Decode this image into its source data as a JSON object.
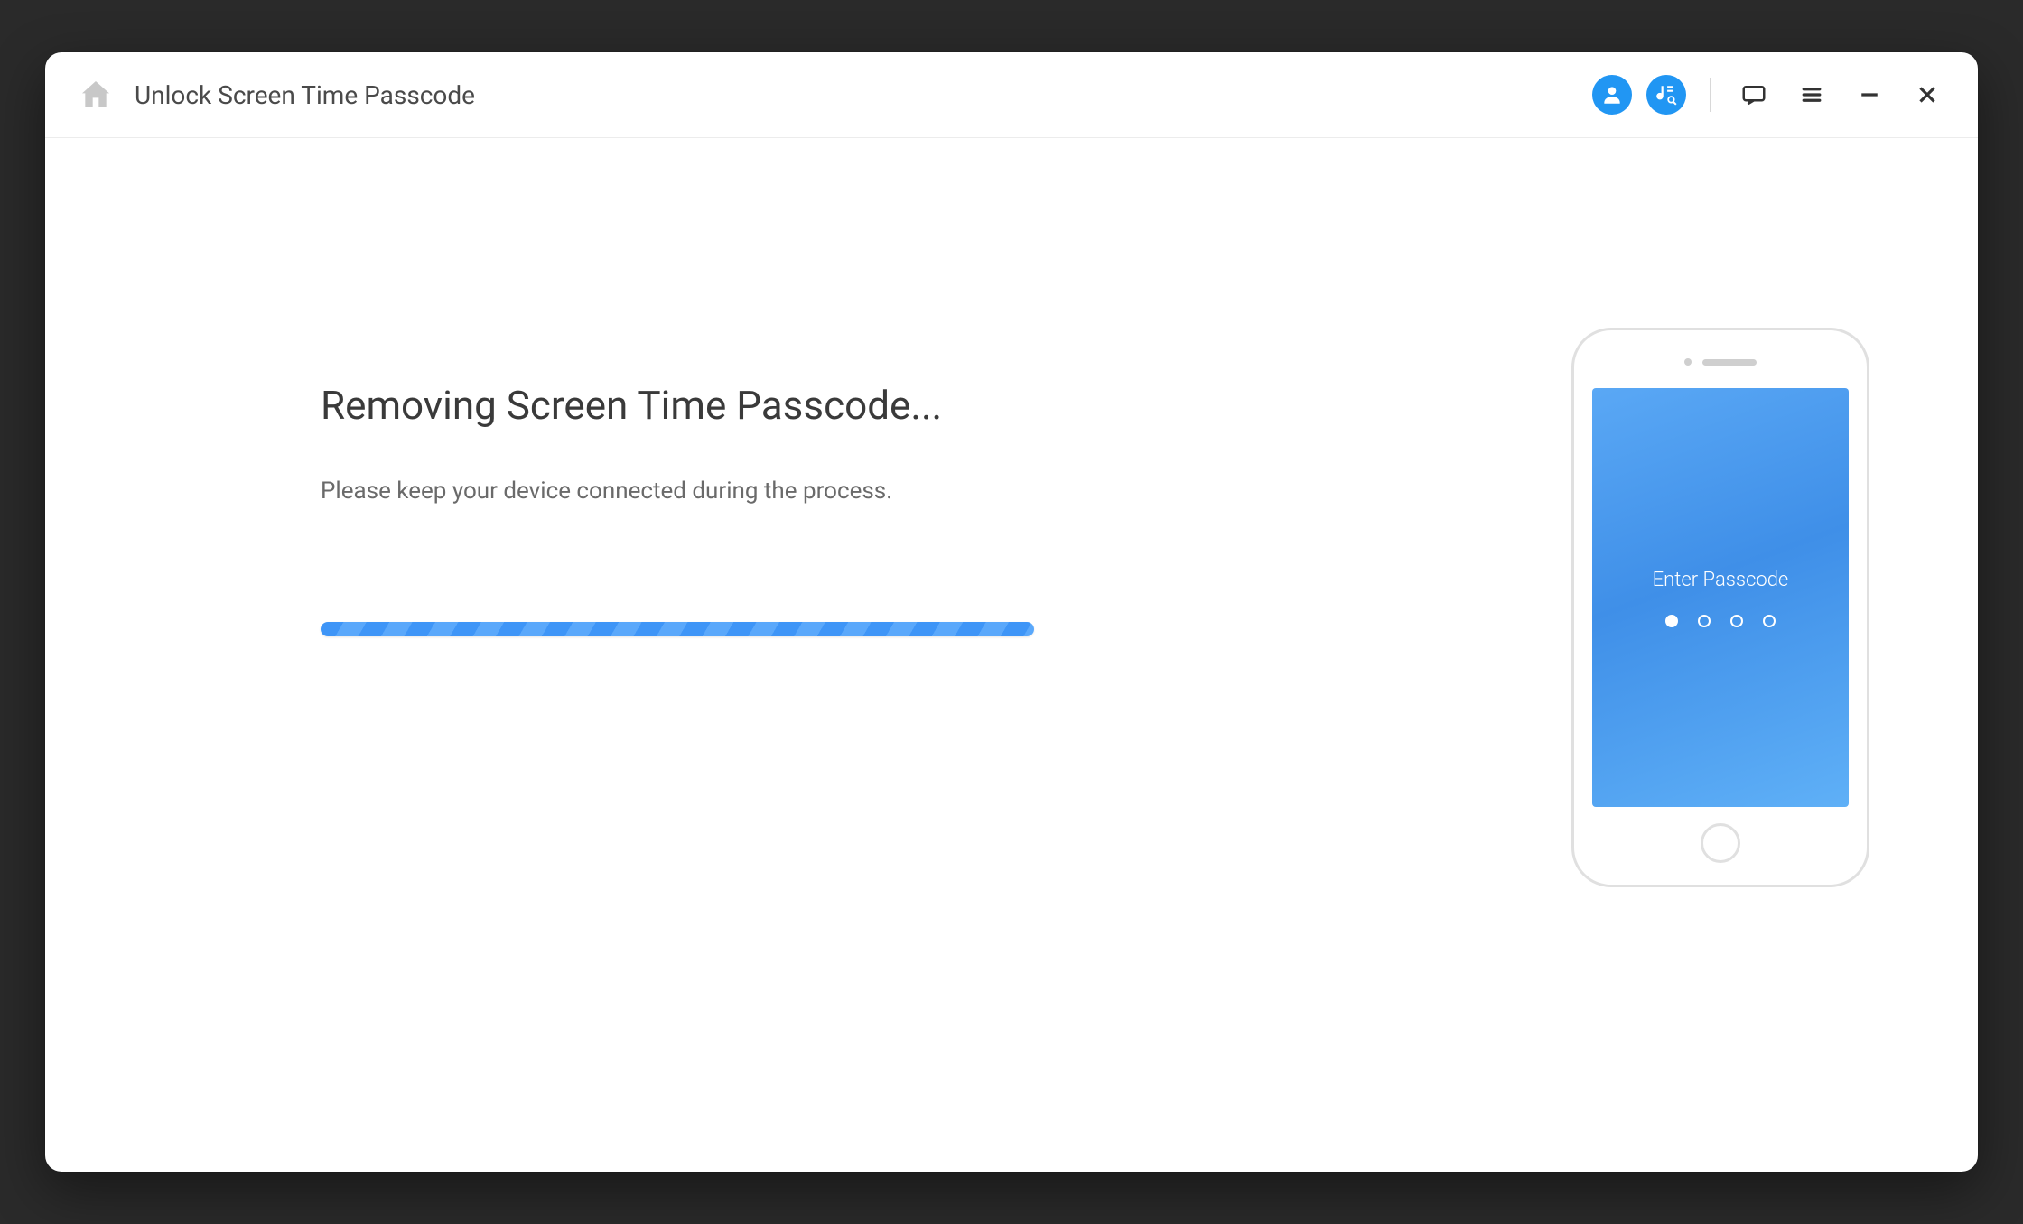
{
  "titlebar": {
    "title": "Unlock Screen Time Passcode"
  },
  "main": {
    "heading": "Removing Screen Time Passcode...",
    "subtext": "Please keep your device connected during the process."
  },
  "phone": {
    "passcode_label": "Enter Passcode"
  }
}
